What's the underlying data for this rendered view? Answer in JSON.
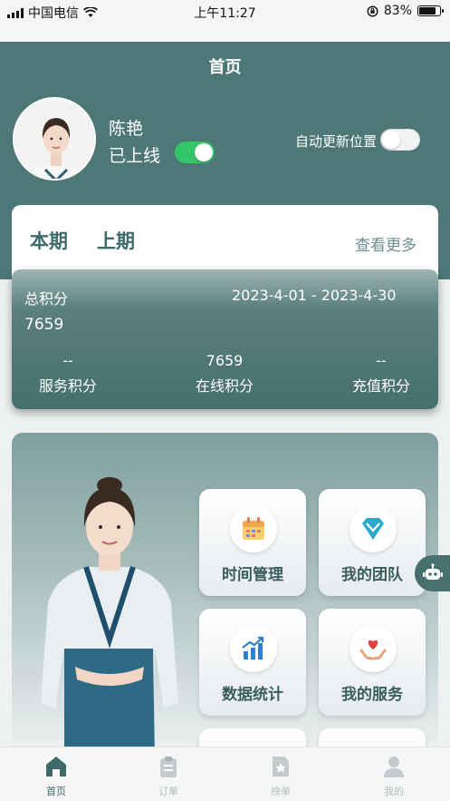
{
  "status_bar": {
    "carrier": "中国电信",
    "time": "上午11:27",
    "battery_percent": "83%",
    "battery_level": 0.83
  },
  "nav": {
    "title": "首页"
  },
  "user": {
    "name": "陈艳",
    "online_label": "已上线",
    "online": true
  },
  "auto_location": {
    "label": "自动更新位置",
    "enabled": false
  },
  "period_tabs": [
    {
      "label": "本期",
      "active": true
    },
    {
      "label": "上期",
      "active": false
    }
  ],
  "see_more": "查看更多",
  "points": {
    "total_label": "总积分",
    "date_range": "2023-4-01 - 2023-4-30",
    "total": "7659",
    "breakdown": [
      {
        "value": "--",
        "label": "服务积分"
      },
      {
        "value": "7659",
        "label": "在线积分"
      },
      {
        "value": "--",
        "label": "充值积分"
      }
    ]
  },
  "features": [
    {
      "label": "时间管理",
      "icon": "calendar-icon"
    },
    {
      "label": "我的团队",
      "icon": "team-diamond-icon"
    },
    {
      "label": "数据统计",
      "icon": "bar-chart-icon"
    },
    {
      "label": "我的服务",
      "icon": "heart-hands-icon"
    }
  ],
  "tabbar": [
    {
      "label": "首页",
      "icon": "home-icon",
      "active": true
    },
    {
      "label": "订单",
      "icon": "clipboard-icon",
      "active": false
    },
    {
      "label": "榜单",
      "icon": "star-document-icon",
      "active": false
    },
    {
      "label": "我的",
      "icon": "user-icon",
      "active": false
    }
  ],
  "colors": {
    "primary": "#4d7877",
    "toggle_on": "#34c569",
    "accent_text": "#3d6b69"
  }
}
